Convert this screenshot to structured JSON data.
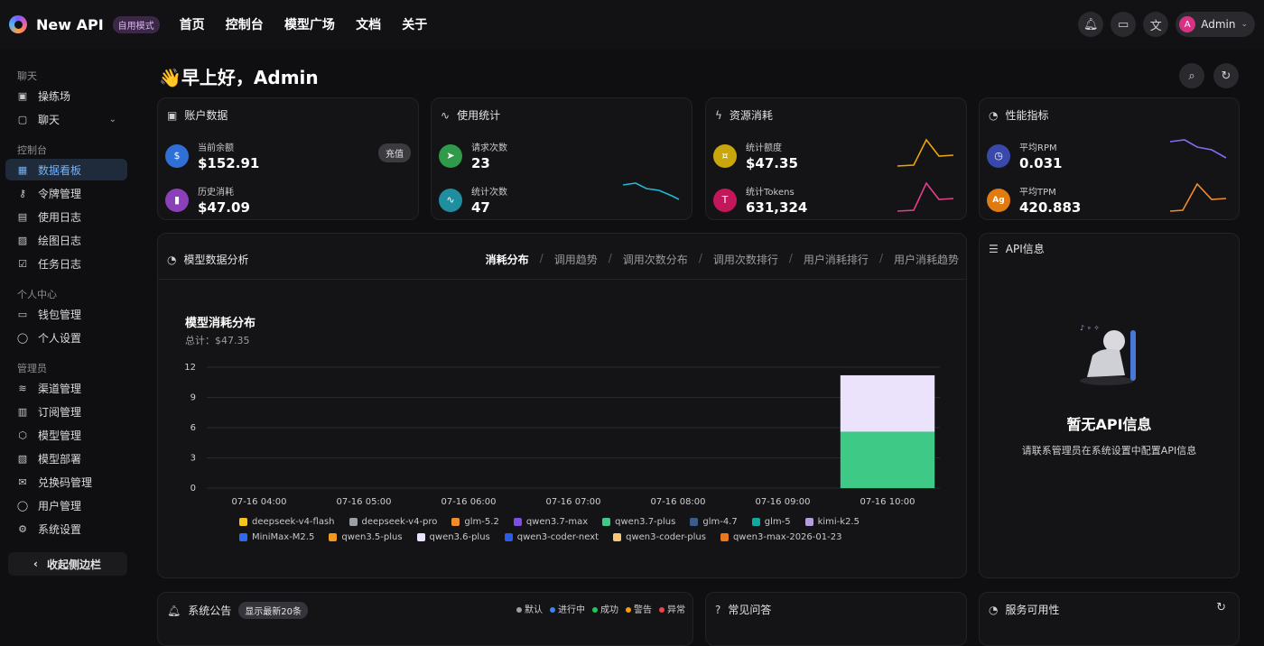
{
  "header": {
    "brand": "New API",
    "mode_badge": "自用模式",
    "nav": [
      "首页",
      "控制台",
      "模型广场",
      "文档",
      "关于"
    ],
    "user": "Admin",
    "user_initial": "A"
  },
  "sidebar": {
    "sections": [
      {
        "title": "聊天",
        "items": [
          {
            "label": "操练场",
            "icon": "playground-icon"
          },
          {
            "label": "聊天",
            "icon": "chat-icon",
            "expandable": true
          }
        ]
      },
      {
        "title": "控制台",
        "items": [
          {
            "label": "数据看板",
            "icon": "dashboard-icon",
            "active": true
          },
          {
            "label": "令牌管理",
            "icon": "key-icon"
          },
          {
            "label": "使用日志",
            "icon": "calendar-icon"
          },
          {
            "label": "绘图日志",
            "icon": "image-icon"
          },
          {
            "label": "任务日志",
            "icon": "task-icon"
          }
        ]
      },
      {
        "title": "个人中心",
        "items": [
          {
            "label": "钱包管理",
            "icon": "wallet-icon"
          },
          {
            "label": "个人设置",
            "icon": "user-icon"
          }
        ]
      },
      {
        "title": "管理员",
        "items": [
          {
            "label": "渠道管理",
            "icon": "layers-icon"
          },
          {
            "label": "订阅管理",
            "icon": "subscription-icon"
          },
          {
            "label": "模型管理",
            "icon": "box-icon"
          },
          {
            "label": "模型部署",
            "icon": "deploy-icon"
          },
          {
            "label": "兑换码管理",
            "icon": "gift-icon"
          },
          {
            "label": "用户管理",
            "icon": "users-icon"
          },
          {
            "label": "系统设置",
            "icon": "settings-icon"
          }
        ]
      }
    ],
    "collapse_label": "收起侧边栏"
  },
  "greeting": "👋早上好，Admin",
  "cards": {
    "account": {
      "title": "账户数据",
      "balance_label": "当前余额",
      "balance": "$152.91",
      "recharge": "充值",
      "spent_label": "历史消耗",
      "spent": "$47.09"
    },
    "usage": {
      "title": "使用统计",
      "req_label": "请求次数",
      "req": "23",
      "stat_label": "统计次数",
      "stat": "47"
    },
    "resource": {
      "title": "资源消耗",
      "quota_label": "统计额度",
      "quota": "$47.35",
      "tokens_label": "统计Tokens",
      "tokens": "631,324"
    },
    "perf": {
      "title": "性能指标",
      "rpm_label": "平均RPM",
      "rpm": "0.031",
      "tpm_label": "平均TPM",
      "tpm": "420.883"
    }
  },
  "analysis": {
    "title": "模型数据分析",
    "tabs": [
      "消耗分布",
      "调用趋势",
      "调用次数分布",
      "调用次数排行",
      "用户消耗排行",
      "用户消耗趋势"
    ],
    "active_tab": "消耗分布"
  },
  "chart_data": {
    "type": "bar",
    "title": "模型消耗分布",
    "subtitle": "总计：$47.35",
    "categories": [
      "07-16 04:00",
      "07-16 05:00",
      "07-16 06:00",
      "07-16 07:00",
      "07-16 08:00",
      "07-16 09:00",
      "07-16 10:00"
    ],
    "ylim": [
      0,
      12
    ],
    "yticks": [
      0,
      3,
      6,
      9,
      12
    ],
    "stacked": true,
    "series": [
      {
        "name": "qwen3.7-plus",
        "color": "#3ec987",
        "values": [
          0,
          0,
          0,
          0,
          0,
          0,
          5.6
        ]
      },
      {
        "name": "qwen3.6-plus",
        "color": "#ebe3fb",
        "values": [
          0,
          0,
          0,
          0,
          0,
          0,
          5.6
        ]
      }
    ],
    "legend": [
      {
        "name": "deepseek-v4-flash",
        "color": "#f5c518"
      },
      {
        "name": "deepseek-v4-pro",
        "color": "#9aa0a6"
      },
      {
        "name": "glm-5.2",
        "color": "#f08c2e"
      },
      {
        "name": "qwen3.7-max",
        "color": "#7b4fe0"
      },
      {
        "name": "qwen3.7-plus",
        "color": "#3ec987"
      },
      {
        "name": "glm-4.7",
        "color": "#3b5b8c"
      },
      {
        "name": "glm-5",
        "color": "#13a89e"
      },
      {
        "name": "kimi-k2.5",
        "color": "#b39ddb"
      },
      {
        "name": "MiniMax-M2.5",
        "color": "#2f6bf0"
      },
      {
        "name": "qwen3.5-plus",
        "color": "#f39a1e"
      },
      {
        "name": "qwen3.6-plus",
        "color": "#ebe3fb"
      },
      {
        "name": "qwen3-coder-next",
        "color": "#2c5be8"
      },
      {
        "name": "qwen3-coder-plus",
        "color": "#f7c873"
      },
      {
        "name": "qwen3-max-2026-01-23",
        "color": "#e8791f"
      }
    ]
  },
  "api_info": {
    "title": "API信息",
    "empty_title": "暂无API信息",
    "empty_desc": "请联系管理员在系统设置中配置API信息"
  },
  "bottom": {
    "notice_title": "系统公告",
    "notice_badge": "显示最新20条",
    "status": [
      {
        "label": "默认",
        "color": "#9aa0a6"
      },
      {
        "label": "进行中",
        "color": "#3b82f6"
      },
      {
        "label": "成功",
        "color": "#22c55e"
      },
      {
        "label": "警告",
        "color": "#f59e0b"
      },
      {
        "label": "异常",
        "color": "#ef4444"
      }
    ],
    "faq_title": "常见问答",
    "uptime_title": "服务可用性"
  }
}
